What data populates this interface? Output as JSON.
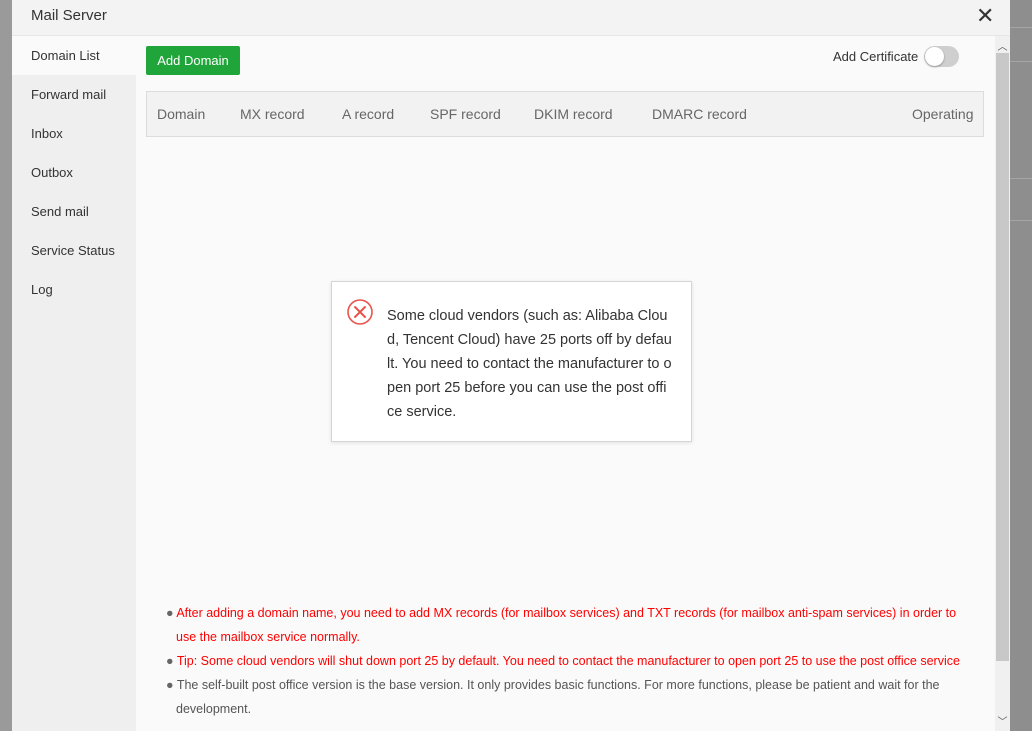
{
  "modal": {
    "title": "Mail Server",
    "close_icon": "close-icon"
  },
  "sidebar": {
    "items": [
      {
        "label": "Domain List",
        "active": true
      },
      {
        "label": "Forward mail"
      },
      {
        "label": "Inbox"
      },
      {
        "label": "Outbox"
      },
      {
        "label": "Send mail"
      },
      {
        "label": "Service Status"
      },
      {
        "label": "Log"
      }
    ]
  },
  "toolbar": {
    "add_domain_label": "Add Domain",
    "add_certificate_label": "Add Certificate",
    "add_certificate_enabled": false
  },
  "table": {
    "columns": [
      "Domain",
      "MX record",
      "A record",
      "SPF record",
      "DKIM record",
      "DMARC record",
      "Operating"
    ]
  },
  "notes": [
    {
      "text": "After adding a domain name, you need to add MX records (for mailbox services) and TXT records (for mailbox anti-spam services) in order to use the mailbox service normally.",
      "color": "#ff0000"
    },
    {
      "text": "Tip: Some cloud vendors will shut down port 25 by default. You need to contact the manufacturer to open port 25 to use the post office service",
      "color": "#ff0000"
    },
    {
      "text": "The self-built post office version is the base version. It only provides basic functions. For more functions, please be patient and wait for the development.",
      "color": "#555555"
    }
  ],
  "toast": {
    "icon": "error-circle-x-icon",
    "color": "#e8534a",
    "message": "Some cloud vendors (such as: Alibaba Cloud, Tencent Cloud) have 25 ports off by default. You need to contact the manufacturer to open port 25 before you can use the post office service."
  }
}
